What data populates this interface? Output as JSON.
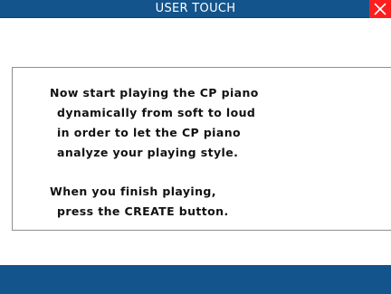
{
  "window": {
    "title": "USER TOUCH",
    "close_icon": "close-icon"
  },
  "message": {
    "paragraph1": [
      "Now start playing the CP piano",
      "dynamically from soft to loud",
      "in order to let the CP piano",
      "analyze your playing style."
    ],
    "paragraph2": [
      "When you finish playing,",
      "press the CREATE button."
    ]
  },
  "colors": {
    "titlebar": "#14548c",
    "bottombar": "#14548c",
    "close_button": "#ff1e1e",
    "background": "#ffffff"
  }
}
